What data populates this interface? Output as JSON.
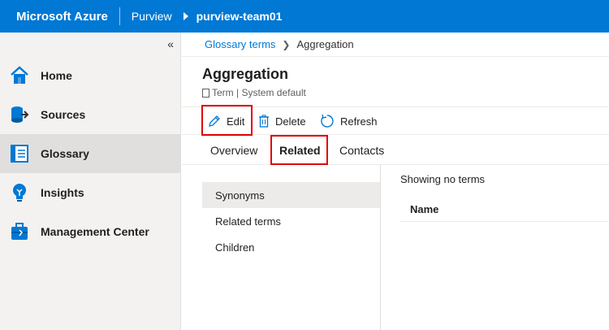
{
  "topbar": {
    "brand": "Microsoft Azure",
    "service": "Purview",
    "account": "purview-team01",
    "color": "#0078d4"
  },
  "sidebar": {
    "collapse_glyph": "«",
    "items": [
      {
        "label": "Home",
        "icon": "home-icon"
      },
      {
        "label": "Sources",
        "icon": "sources-icon"
      },
      {
        "label": "Glossary",
        "icon": "glossary-icon",
        "active": true
      },
      {
        "label": "Insights",
        "icon": "insights-icon"
      },
      {
        "label": "Management Center",
        "icon": "management-icon"
      }
    ]
  },
  "breadcrumb": {
    "link": "Glossary terms",
    "current": "Aggregation"
  },
  "page": {
    "title": "Aggregation",
    "subtitle": "Term | System default"
  },
  "toolbar": {
    "edit_label": "Edit",
    "delete_label": "Delete",
    "refresh_label": "Refresh",
    "highlight_color": "#e00000"
  },
  "tabs": [
    {
      "label": "Overview"
    },
    {
      "label": "Related",
      "selected": true
    },
    {
      "label": "Contacts"
    }
  ],
  "related": {
    "categories": [
      "Synonyms",
      "Related terms",
      "Children"
    ],
    "selected_category": "Synonyms",
    "empty_message": "Showing no terms",
    "column_header": "Name"
  }
}
